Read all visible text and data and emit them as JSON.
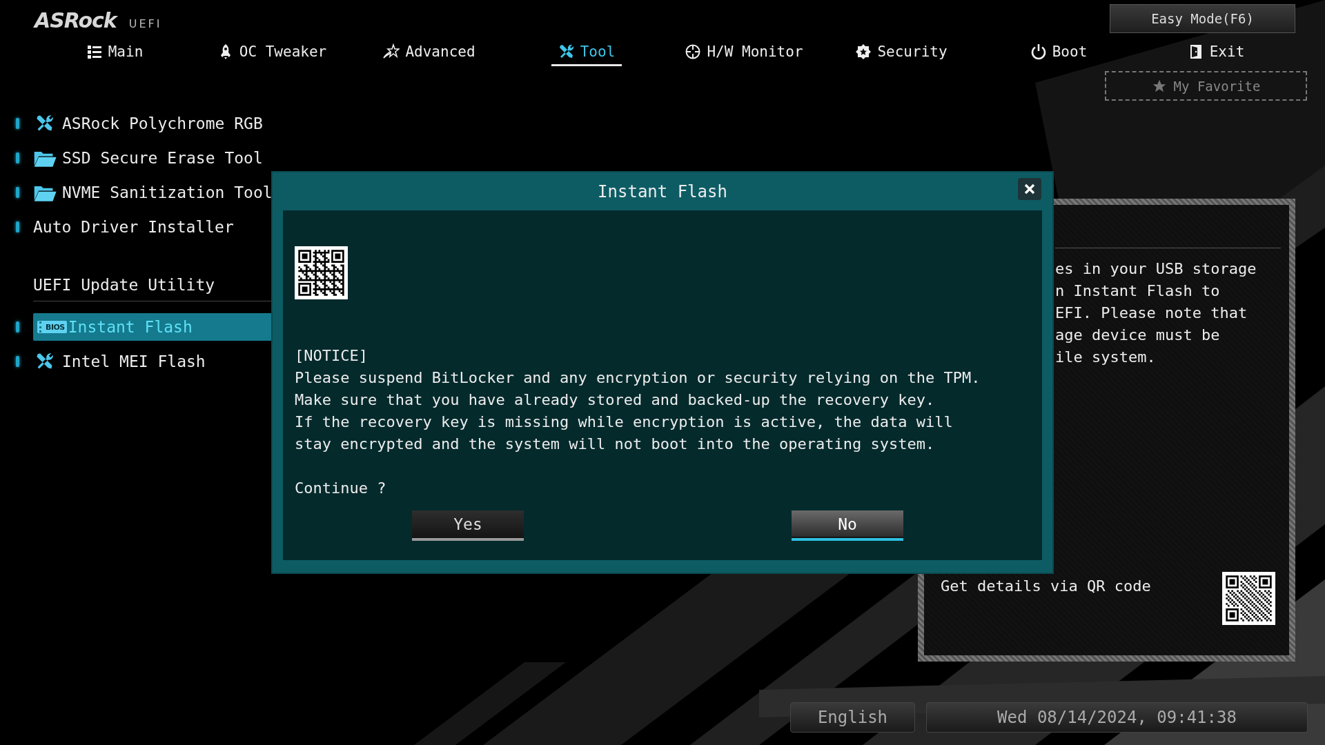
{
  "logo": {
    "brand": "ASRock",
    "product": "UEFI"
  },
  "easy_mode_button": "Easy Mode(F6)",
  "tabs": [
    {
      "label": "Main",
      "selected": false
    },
    {
      "label": "OC Tweaker",
      "selected": false
    },
    {
      "label": "Advanced",
      "selected": false
    },
    {
      "label": "Tool",
      "selected": true
    },
    {
      "label": "H/W Monitor",
      "selected": false
    },
    {
      "label": "Security",
      "selected": false
    },
    {
      "label": "Boot",
      "selected": false
    },
    {
      "label": "Exit",
      "selected": false
    }
  ],
  "favorite_button": "My Favorite",
  "sidebar": {
    "items": [
      {
        "kind": "tool",
        "label": "ASRock Polychrome RGB",
        "selected": false
      },
      {
        "kind": "folder",
        "label": "SSD Secure Erase Tool",
        "selected": false
      },
      {
        "kind": "folder",
        "label": "NVME Sanitization Tool",
        "selected": false
      },
      {
        "kind": "plain",
        "label": "Auto Driver Installer",
        "selected": false
      },
      {
        "kind": "heading",
        "label": "UEFI Update Utility",
        "selected": false
      },
      {
        "kind": "bios",
        "badge": "BIOS",
        "label": "Instant Flash",
        "selected": true
      },
      {
        "kind": "tool",
        "label": "Intel MEI Flash",
        "selected": false
      }
    ]
  },
  "help_panel": {
    "lines": [
      "es in your USB storage",
      "n Instant Flash to",
      "EFI. Please note that",
      "age device must be",
      "ile system."
    ],
    "qr_caption": "Get details via QR code"
  },
  "dialog": {
    "title": "Instant Flash",
    "notice_lines": [
      "[NOTICE]",
      "Please suspend BitLocker and any encryption or security relying on the TPM.",
      "Make sure that you have already stored and backed-up the recovery key.",
      "If the recovery key is missing while encryption is active, the data will",
      "stay encrypted and the system will not boot into the operating system."
    ],
    "prompt": "Continue ?",
    "buttons": [
      {
        "label": "Yes",
        "selected": false
      },
      {
        "label": "No",
        "selected": true
      }
    ]
  },
  "status_bar": {
    "language": "English",
    "datetime": "Wed 08/14/2024, 09:41:38"
  }
}
